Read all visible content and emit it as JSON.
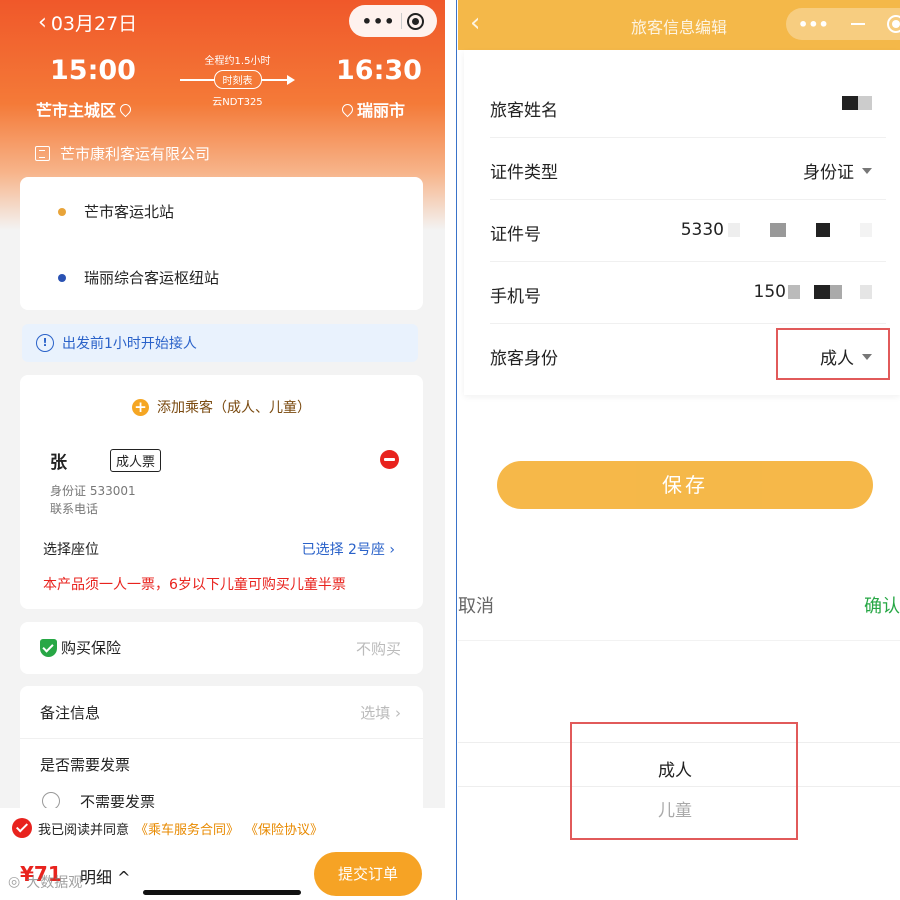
{
  "left": {
    "nav_date": "03月27日",
    "duration": "全程约1.5小时",
    "timetable": "时刻表",
    "bus_no": "云NDT325",
    "depart_time": "15:00",
    "arrive_time": "16:30",
    "depart_place": "芒市主城区",
    "arrive_place": "瑞丽市",
    "company": "芒市康利客运有限公司",
    "stops": [
      "芒市客运北站",
      "瑞丽综合客运枢纽站"
    ],
    "notice": "出发前1小时开始接人",
    "add_passenger": "添加乘客（成人、儿童）",
    "passenger_name": "张",
    "ticket_type": "成人票",
    "id_label": "身份证 533001",
    "phone_label": "联系电话",
    "seat_label": "选择座位",
    "seat_value": "已选择 2号座",
    "warning": "本产品须一人一票，6岁以下儿童可购买儿童半票",
    "insurance_label": "购买保险",
    "insurance_value": "不购买",
    "remark_label": "备注信息",
    "remark_value": "选填",
    "invoice_label": "是否需要发票",
    "invoice_option": "不需要发票",
    "agree_text": "我已阅读并同意",
    "contract_link": "《乘车服务合同》",
    "insurance_link": "《保险协议》",
    "price": "¥71",
    "detail": "明细",
    "submit": "提交订单",
    "watermark": "大数据观"
  },
  "right": {
    "title": "旅客信息编辑",
    "fields": [
      {
        "label": "旅客姓名",
        "value": ""
      },
      {
        "label": "证件类型",
        "value": "身份证"
      },
      {
        "label": "证件号",
        "value": "5330"
      },
      {
        "label": "手机号",
        "value": "150"
      },
      {
        "label": "旅客身份",
        "value": "成人"
      }
    ],
    "save": "保存",
    "cancel": "取消",
    "confirm": "确认",
    "picker_options": [
      "成人",
      "儿童"
    ]
  },
  "colors": {
    "hero_orange": "#f0582a",
    "accent_yellow": "#f5b23a",
    "link_blue": "#2a62c9",
    "danger_red": "#e8231e",
    "confirm_green": "#27a745",
    "highlight_red": "#e15a5a"
  }
}
